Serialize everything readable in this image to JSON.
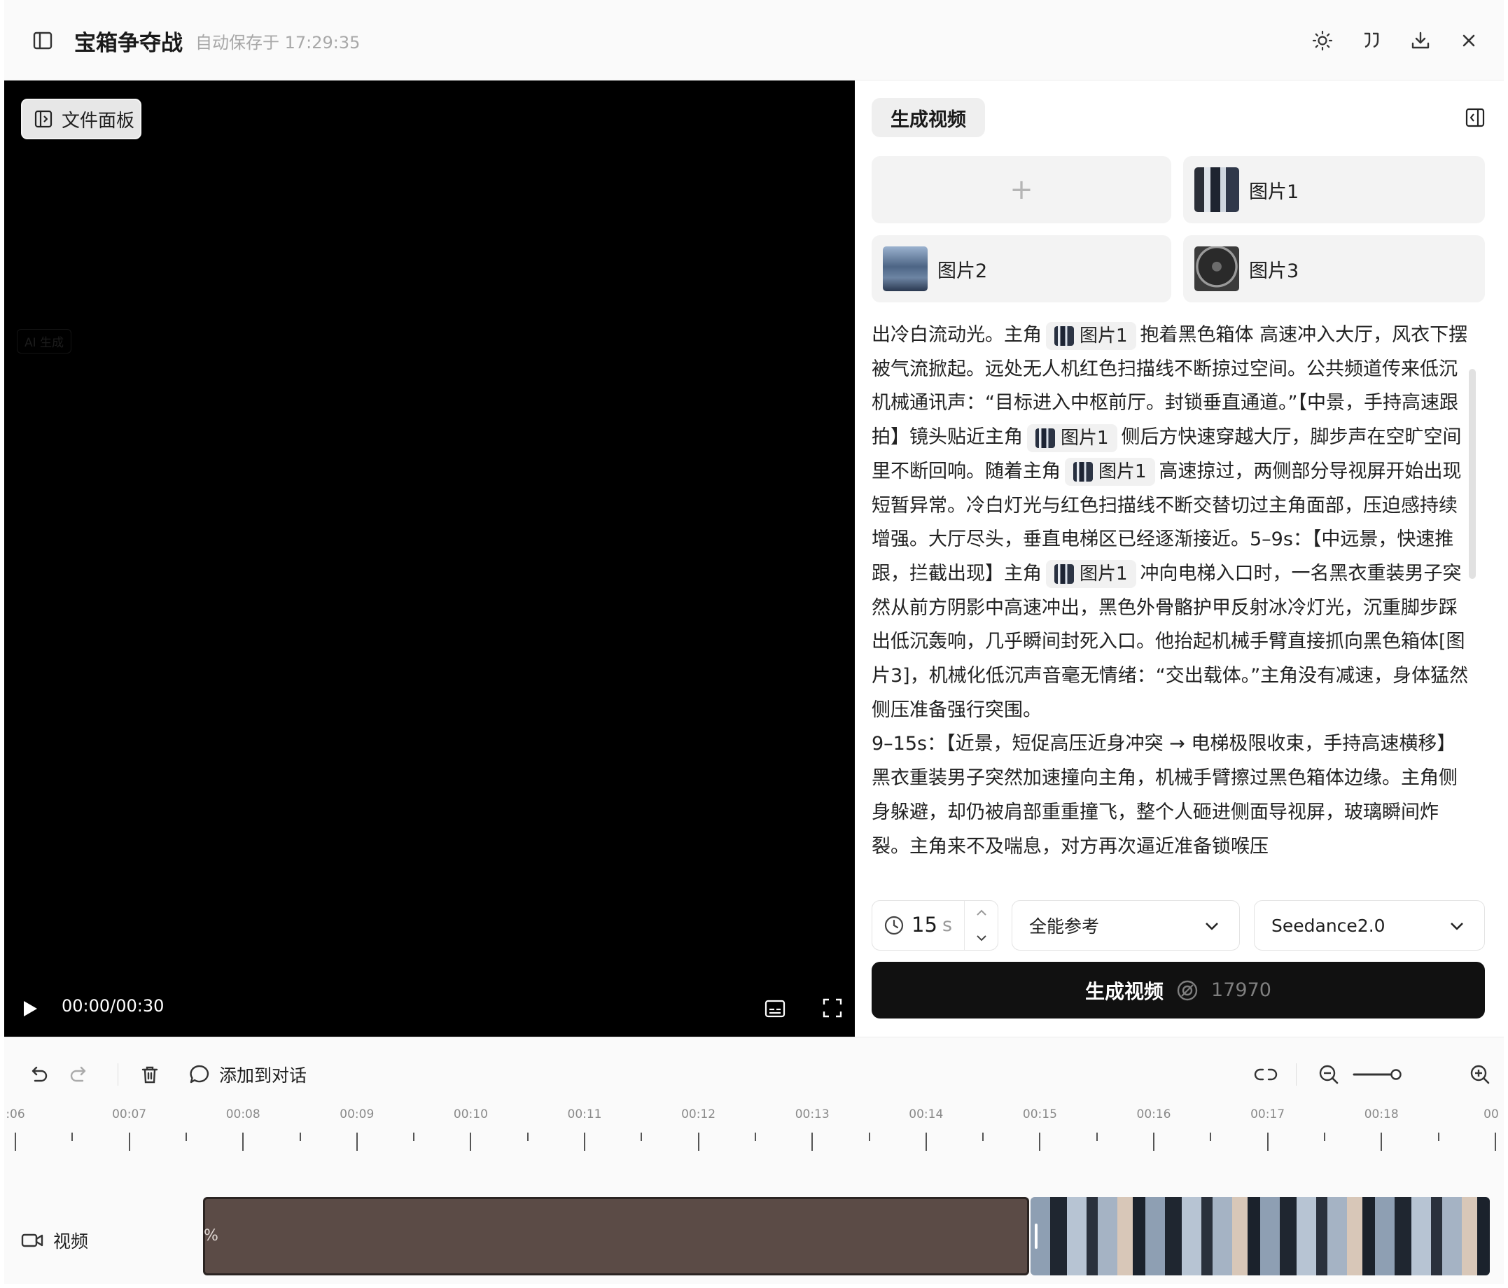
{
  "header": {
    "title": "宝箱争夺战",
    "status": "自动保存于 17:29:35"
  },
  "video": {
    "file_panel_label": "文件面板",
    "ai_tag": "AI 生成",
    "timecode": "00:00/00:30"
  },
  "generate": {
    "tab_label": "生成视频",
    "add_symbol": "+",
    "images": [
      {
        "label": "图片1"
      },
      {
        "label": "图片2"
      },
      {
        "label": "图片3"
      }
    ],
    "prompt": {
      "s1": "出冷白流动光。主角",
      "c1": "图片1",
      "s2": "抱着黑色箱体 高速冲入大厅，风衣下摆被气流掀起。远处无人机红色扫描线不断掠过空间。公共频道传来低沉机械通讯声：“目标进入中枢前厅。封锁垂直通道。”【中景，手持高速跟拍】镜头贴近主角",
      "c2": "图片1",
      "s3": "侧后方快速穿越大厅，脚步声在空旷空间里不断回响。随着主角",
      "c3": "图片1",
      "s4": "高速掠过，两侧部分导视屏开始出现短暂异常。冷白灯光与红色扫描线不断交替切过主角面部，压迫感持续增强。大厅尽头，垂直电梯区已经逐渐接近。5–9s：【中远景，快速推跟，拦截出现】主角",
      "c4": "图片1",
      "s5": "冲向电梯入口时，一名黑衣重装男子突然从前方阴影中高速冲出，黑色外骨骼护甲反射冰冷灯光，沉重脚步踩出低沉轰响，几乎瞬间封死入口。他抬起机械手臂直接抓向黑色箱体[图片3]，机械化低沉声音毫无情绪：“交出载体。”主角没有减速，身体猛然侧压准备强行突围。",
      "p2": "9–15s：【近景，短促高压近身冲突 → 电梯极限收束，手持高速横移】黑衣重装男子突然加速撞向主角，机械手臂擦过黑色箱体边缘。主角侧身躲避，却仍被肩部重重撞飞，整个人砸进侧面导视屏，玻璃瞬间炸裂。主角来不及喘息，对方再次逼近准备锁喉压"
    },
    "duration_value": "15",
    "duration_unit": "s",
    "mode": "全能参考",
    "model": "Seedance2.0",
    "button_label": "生成视频",
    "credits": "17970"
  },
  "timeline": {
    "add_to_chat": "添加到对话",
    "ruler_labels": [
      ":06",
      "00:07",
      "00:08",
      "00:09",
      "00:10",
      "00:11",
      "00:12",
      "00:13",
      "00:14",
      "00:15",
      "00:16",
      "00:17",
      "00:18",
      "00"
    ],
    "track_label": "视频",
    "clip_progress": "%"
  },
  "colors": {
    "accent_dark": "#111111",
    "clip_brown": "#5b4b46",
    "panel_bg": "#f3f3f3"
  }
}
